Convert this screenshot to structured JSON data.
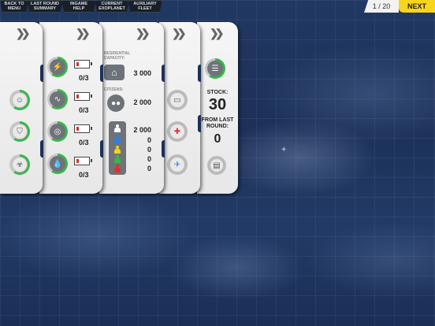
{
  "topbar": {
    "buttons": [
      {
        "label": "BACK TO\nMENU"
      },
      {
        "label": "LAST ROUND\nSUMMARY"
      },
      {
        "label": "INGAME\nHELP"
      },
      {
        "label": "CURRENT\nEXOPLANET"
      },
      {
        "label": "AUXILIARY\nFLEET"
      }
    ],
    "round": "1 / 20",
    "next_label": "NEXT"
  },
  "panel_happiness": {
    "icons": [
      "smiley-icon",
      "shield-icon",
      "bio-icon"
    ]
  },
  "panel_resources": {
    "rows": [
      {
        "icon": "energy-icon",
        "value": "0/3"
      },
      {
        "icon": "pulse-icon",
        "value": "0/3"
      },
      {
        "icon": "planet-icon",
        "value": "0/3"
      },
      {
        "icon": "water-icon",
        "value": "0/3"
      }
    ]
  },
  "panel_population": {
    "residential_label": "RESIDENTIAL\nCAPACITY:",
    "residential_value": "3 000",
    "citizens_label": "CITIZENS:",
    "citizens_value": "2 000",
    "groups": [
      {
        "color": "#ffffff",
        "value": "2 000"
      },
      {
        "color": "#2f7fe0",
        "value": "0"
      },
      {
        "color": "#f2d21c",
        "value": "0"
      },
      {
        "color": "#3bb54a",
        "value": "0"
      },
      {
        "color": "#e03030",
        "value": "0"
      }
    ]
  },
  "panel_buildings": {
    "icons": [
      "factory-icon",
      "medical-icon",
      "emblem-icon"
    ]
  },
  "panel_stock": {
    "stock_label": "STOCK:",
    "stock_value": "30",
    "from_last_label": "FROM LAST\nROUND:",
    "from_last_value": "0"
  },
  "colors": {
    "accent": "#f6d51c",
    "ring_green": "#3bb54a",
    "panel": "#efefef"
  }
}
